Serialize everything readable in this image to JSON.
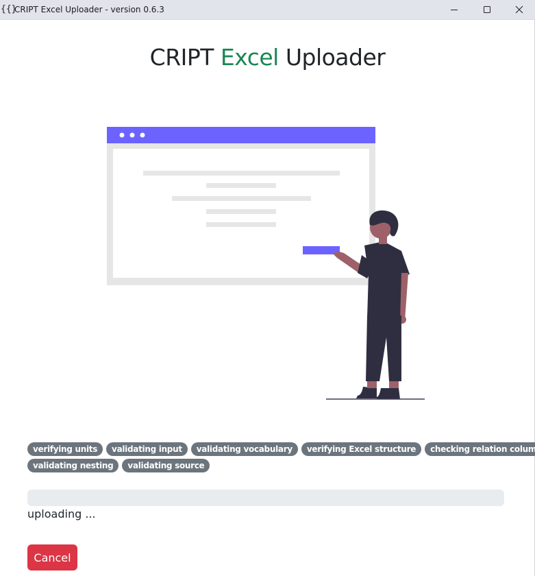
{
  "window": {
    "title": "CRIPT Excel Uploader - version 0.6.3",
    "icon_glyph": "{{}"
  },
  "header": {
    "title_part1": "CRIPT",
    "title_part2": "Excel",
    "title_part3": "Uploader",
    "accent_color": "#198754"
  },
  "illustration": {
    "name": "presentation-illustration",
    "colors": {
      "browser_bar": "#6c63ff",
      "frame": "#e6e6e6",
      "text_lines": "#e6e6e6",
      "highlight": "#6c63ff",
      "figure_dark": "#2f2e41",
      "skin": "#9e616a"
    }
  },
  "badges": [
    [
      "verifying units",
      "validating input",
      "validating vocabulary",
      "verifying Excel structure",
      "checking relation columns"
    ],
    [
      "validating nesting",
      "validating source"
    ]
  ],
  "progress": {
    "value": 0,
    "status": "uploading ..."
  },
  "buttons": {
    "cancel_label": "Cancel",
    "cancel_color": "#dc3545"
  }
}
